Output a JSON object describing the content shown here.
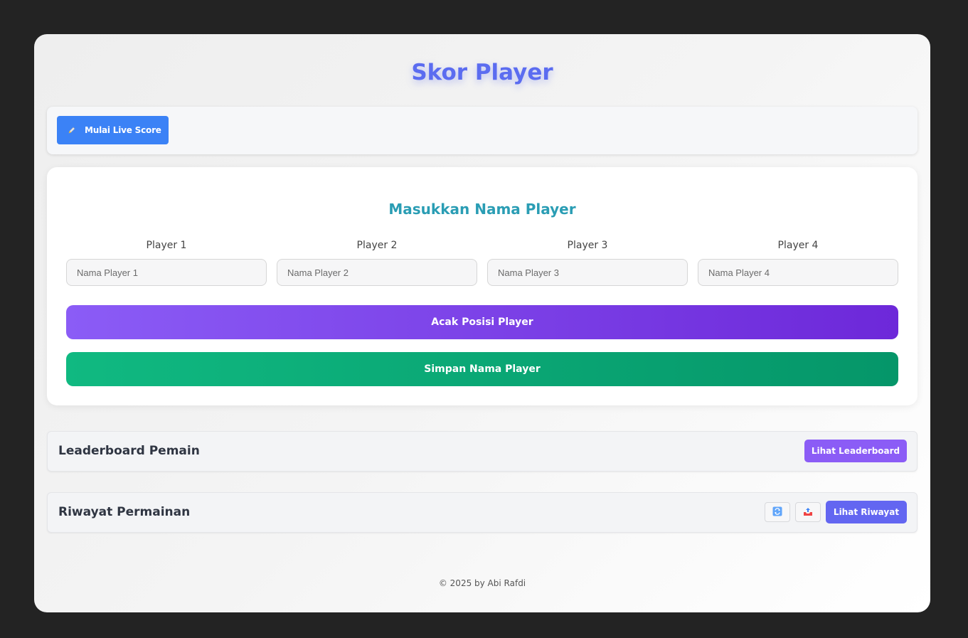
{
  "page": {
    "title": "Skor Player"
  },
  "live_score": {
    "button_label": "Mulai Live Score",
    "icon": "pen-icon"
  },
  "player_form": {
    "title": "Masukkan Nama Player",
    "players": [
      {
        "label": "Player 1",
        "placeholder": "Nama Player 1",
        "value": ""
      },
      {
        "label": "Player 2",
        "placeholder": "Nama Player 2",
        "value": ""
      },
      {
        "label": "Player 3",
        "placeholder": "Nama Player 3",
        "value": ""
      },
      {
        "label": "Player 4",
        "placeholder": "Nama Player 4",
        "value": ""
      }
    ],
    "shuffle_label": "Acak Posisi Player",
    "save_label": "Simpan Nama Player"
  },
  "leaderboard": {
    "title": "Leaderboard Pemain",
    "button_label": "Lihat Leaderboard"
  },
  "history": {
    "title": "Riwayat Permainan",
    "refresh_icon": "refresh-icon",
    "export_icon": "export-icon",
    "button_label": "Lihat Riwayat"
  },
  "footer": {
    "text": "© 2025 by Abi Rafdi"
  },
  "colors": {
    "title": "#5b6cf0",
    "live_button": "#3b82f6",
    "panel_title": "#2a9db4",
    "shuffle_gradient": [
      "#8b5cf6",
      "#6d28d9"
    ],
    "save_gradient": [
      "#10b981",
      "#059669"
    ],
    "leaderboard_button": "#8b5cf6",
    "history_button": "#6366f1"
  }
}
